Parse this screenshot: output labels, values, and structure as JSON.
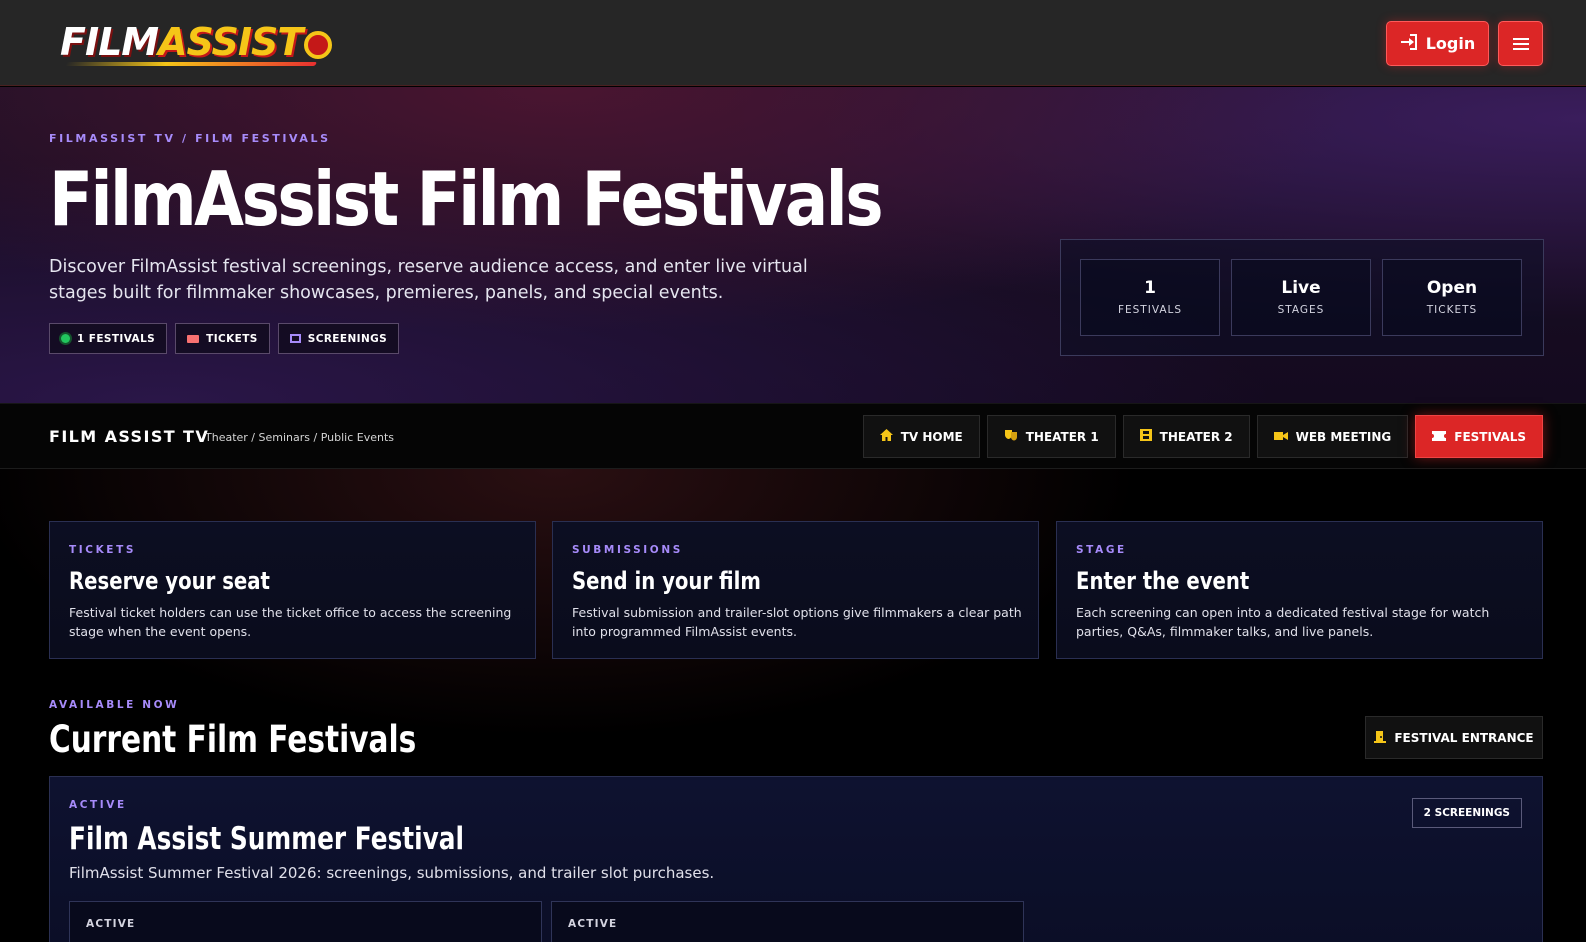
{
  "header": {
    "logo": {
      "film": "FILM",
      "assist": "ASSIST"
    },
    "login_label": "Login",
    "menu_icon": "hamburger-icon"
  },
  "hero": {
    "breadcrumb": "FILMASSIST TV / FILM FESTIVALS",
    "title": "FilmAssist Film Festivals",
    "description": "Discover FilmAssist festival screenings, reserve audience access, and enter live virtual stages built for filmmaker showcases, premieres, panels, and special events.",
    "chips": [
      "1 FESTIVALS",
      "TICKETS",
      "SCREENINGS"
    ],
    "stats": [
      {
        "value": "1",
        "label": "FESTIVALS"
      },
      {
        "value": "Live",
        "label": "STAGES"
      },
      {
        "value": "Open",
        "label": "TICKETS"
      }
    ]
  },
  "subnav": {
    "brand": "FILM ASSIST TV",
    "subtitle": "Theater / Seminars / Public Events",
    "tabs": [
      {
        "label": "TV HOME",
        "icon": "home-icon"
      },
      {
        "label": "THEATER 1",
        "icon": "theater-masks-icon"
      },
      {
        "label": "THEATER 2",
        "icon": "film-icon"
      },
      {
        "label": "WEB MEETING",
        "icon": "video-icon"
      },
      {
        "label": "FESTIVALS",
        "icon": "ticket-icon",
        "active": true
      }
    ]
  },
  "cards": [
    {
      "kicker": "TICKETS",
      "title": "Reserve your seat",
      "text": "Festival ticket holders can use the ticket office to access the screening stage when the event opens."
    },
    {
      "kicker": "SUBMISSIONS",
      "title": "Send in your film",
      "text": "Festival submission and trailer-slot options give filmmakers a clear path into programmed FilmAssist events."
    },
    {
      "kicker": "STAGE",
      "title": "Enter the event",
      "text": "Each screening can open into a dedicated festival stage for watch parties, Q&As, filmmaker talks, and live panels."
    }
  ],
  "festivals_section": {
    "kicker": "AVAILABLE NOW",
    "title": "Current Film Festivals",
    "entrance_label": "FESTIVAL ENTRANCE"
  },
  "festival": {
    "kicker": "ACTIVE",
    "title": "Film Assist Summer Festival",
    "description": "FilmAssist Summer Festival 2026: screenings, submissions, and trailer slot purchases.",
    "badge": "2 SCREENINGS",
    "screenings": [
      {
        "status": "ACTIVE"
      },
      {
        "status": "ACTIVE"
      }
    ]
  },
  "colors": {
    "accent": "#dc2626",
    "kicker": "#a78bfa",
    "gold": "#f5c518"
  }
}
